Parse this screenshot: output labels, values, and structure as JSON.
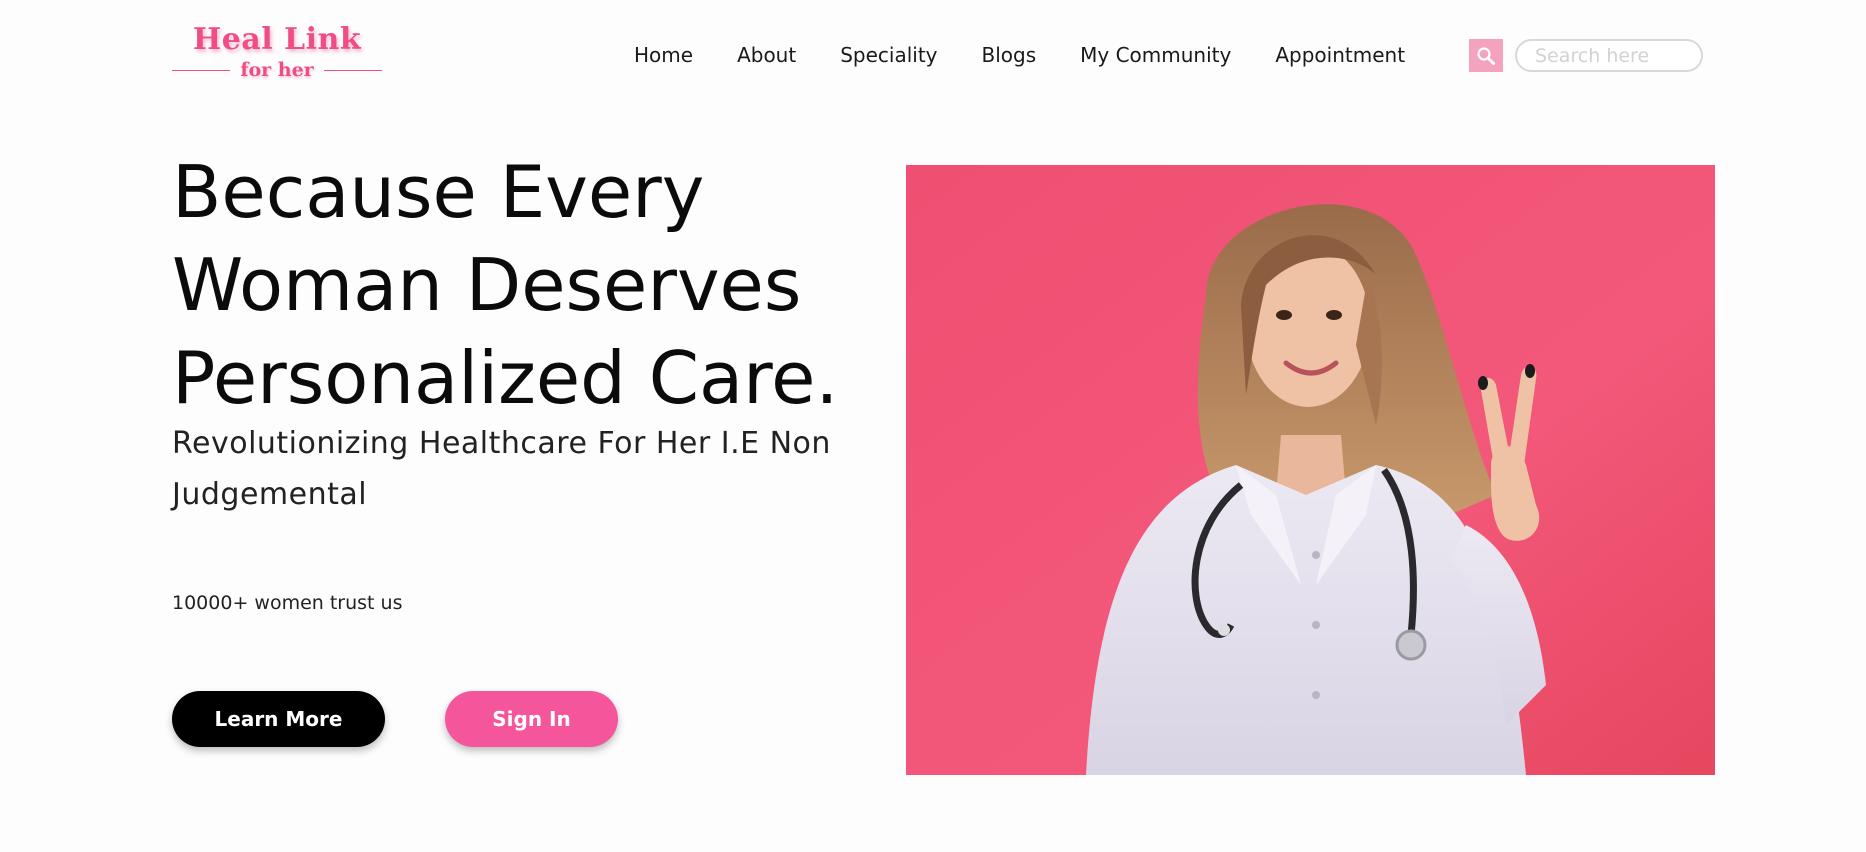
{
  "header": {
    "logo": {
      "main": "Heal Link",
      "sub": "for her"
    },
    "nav": [
      {
        "label": "Home"
      },
      {
        "label": "About"
      },
      {
        "label": "Speciality"
      },
      {
        "label": "Blogs"
      },
      {
        "label": "My Community"
      },
      {
        "label": "Appointment"
      }
    ],
    "search": {
      "icon": "search-icon",
      "placeholder": "Search here",
      "value": ""
    }
  },
  "hero": {
    "title_lines": [
      "Because Every",
      "Woman Deserves",
      "Personalized Care."
    ],
    "subtitle": "Revolutionizing Healthcare For Her I.E Non Judgemental",
    "trust_text": "10000+ women trust us",
    "buttons": {
      "learn_more": "Learn More",
      "sign_in": "Sign In"
    },
    "image": {
      "description_icon": "doctor-photo"
    }
  },
  "colors": {
    "brand_pink": "#f04d86",
    "search_button": "#f4a3bf",
    "sign_in_button": "#f5559a",
    "learn_more_button": "#000000",
    "photo_background": "#ee4e73"
  }
}
